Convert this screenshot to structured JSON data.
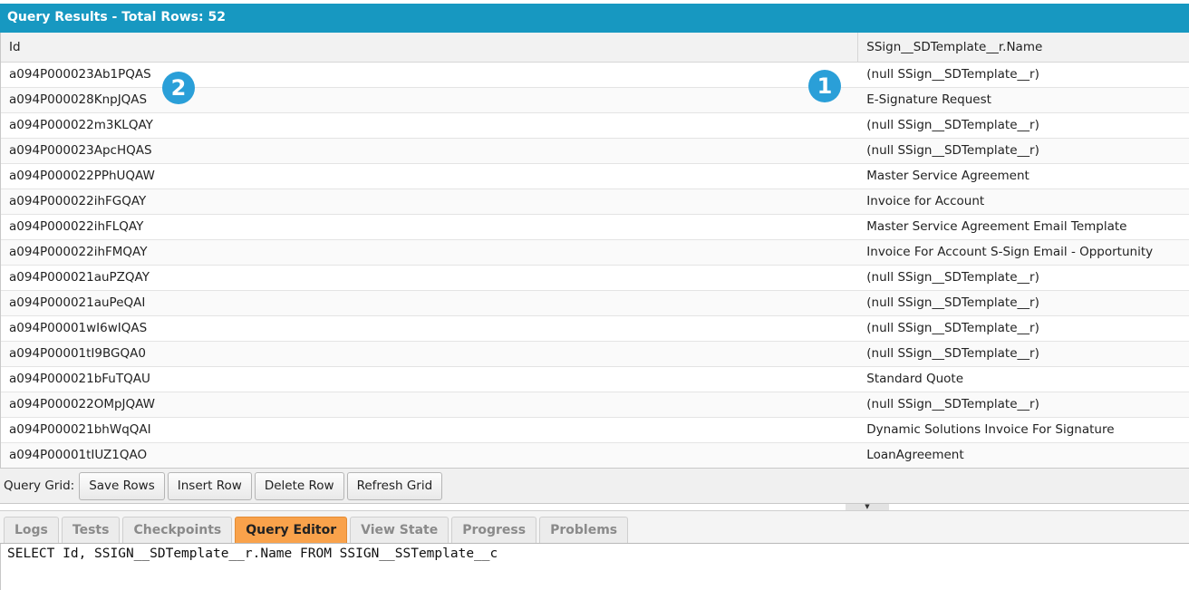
{
  "panel": {
    "title": "Query Results - Total Rows: 52"
  },
  "grid": {
    "columns": [
      "Id",
      "SSign__SDTemplate__r.Name"
    ],
    "rows": [
      [
        "a094P000023Ab1PQAS",
        "(null SSign__SDTemplate__r)"
      ],
      [
        "a094P000028KnpJQAS",
        "E-Signature Request"
      ],
      [
        "a094P000022m3KLQAY",
        "(null SSign__SDTemplate__r)"
      ],
      [
        "a094P000023ApcHQAS",
        "(null SSign__SDTemplate__r)"
      ],
      [
        "a094P000022PPhUQAW",
        "Master Service Agreement"
      ],
      [
        "a094P000022ihFGQAY",
        "Invoice for Account"
      ],
      [
        "a094P000022ihFLQAY",
        "Master Service Agreement Email Template"
      ],
      [
        "a094P000022ihFMQAY",
        "Invoice For Account S-Sign Email - Opportunity"
      ],
      [
        "a094P000021auPZQAY",
        "(null SSign__SDTemplate__r)"
      ],
      [
        "a094P000021auPeQAI",
        "(null SSign__SDTemplate__r)"
      ],
      [
        "a094P00001wI6wIQAS",
        "(null SSign__SDTemplate__r)"
      ],
      [
        "a094P00001tI9BGQA0",
        "(null SSign__SDTemplate__r)"
      ],
      [
        "a094P000021bFuTQAU",
        "Standard Quote"
      ],
      [
        "a094P000022OMpJQAW",
        "(null SSign__SDTemplate__r)"
      ],
      [
        "a094P000021bhWqQAI",
        "Dynamic Solutions Invoice For Signature"
      ],
      [
        "a094P00001tIUZ1QAO",
        "LoanAgreement"
      ]
    ]
  },
  "badges": {
    "one": "1",
    "two": "2",
    "color": "#2a9fd8"
  },
  "toolbar": {
    "label": "Query Grid:",
    "save_rows": "Save Rows",
    "insert_row": "Insert Row",
    "delete_row": "Delete Row",
    "refresh_grid": "Refresh Grid"
  },
  "splitter": {
    "icon": "triangle-down-icon",
    "glyph": "▼"
  },
  "tabs": [
    {
      "label": "Logs",
      "active": false
    },
    {
      "label": "Tests",
      "active": false
    },
    {
      "label": "Checkpoints",
      "active": false
    },
    {
      "label": "Query Editor",
      "active": true
    },
    {
      "label": "View State",
      "active": false
    },
    {
      "label": "Progress",
      "active": false
    },
    {
      "label": "Problems",
      "active": false
    }
  ],
  "editor": {
    "query": "SELECT Id, SSIGN__SDTemplate__r.Name FROM SSIGN__SSTemplate__c"
  },
  "colors": {
    "title_bar": "#1798c1",
    "active_tab": "#f9a24b"
  }
}
